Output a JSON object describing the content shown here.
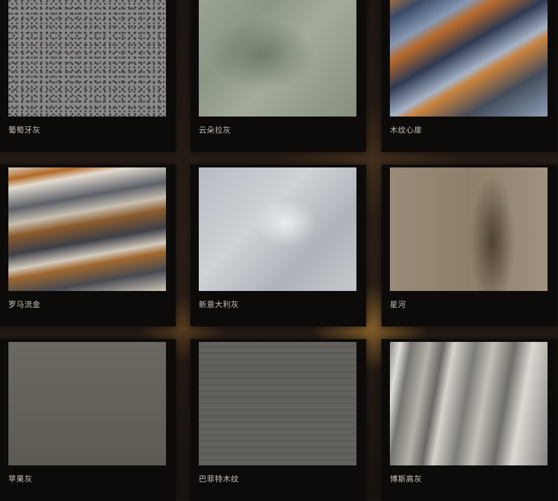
{
  "tiles": [
    {
      "name": "葡萄牙灰"
    },
    {
      "name": "云朵拉灰"
    },
    {
      "name": "木纹心扉"
    },
    {
      "name": "罗马流金"
    },
    {
      "name": "新意大利灰"
    },
    {
      "name": "星河"
    },
    {
      "name": "苹果灰"
    },
    {
      "name": "巴菲特木纹"
    },
    {
      "name": "博斯高灰"
    }
  ]
}
